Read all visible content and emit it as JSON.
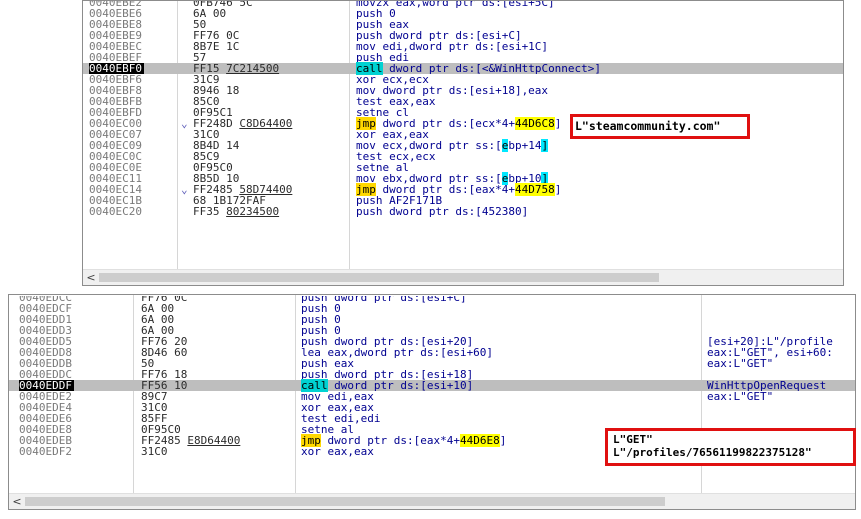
{
  "colors": {
    "selection": "#bebebe",
    "call_highlight": "#00d2d2",
    "jmp_highlight": "#ffd800",
    "callout_border": "#e01010"
  },
  "top_pane": {
    "rows": [
      {
        "addr": "0040EBE2",
        "arrow": "",
        "bytes": "0FB746 5C",
        "ref": "",
        "instr": [
          {
            "t": "movzx eax,word ptr ds:[esi+5C]"
          }
        ],
        "cut": true
      },
      {
        "addr": "0040EBE6",
        "arrow": "",
        "bytes": "6A 00",
        "ref": "",
        "instr": [
          {
            "t": "push 0"
          }
        ]
      },
      {
        "addr": "0040EBE8",
        "arrow": "",
        "bytes": "50",
        "ref": "",
        "instr": [
          {
            "t": "push eax"
          }
        ]
      },
      {
        "addr": "0040EBE9",
        "arrow": "",
        "bytes": "FF76 0C",
        "ref": "",
        "instr": [
          {
            "t": "push dword ptr ds:[esi+C]"
          }
        ]
      },
      {
        "addr": "0040EBEC",
        "arrow": "",
        "bytes": "8B7E 1C",
        "ref": "",
        "instr": [
          {
            "t": "mov edi,dword ptr ds:[esi+1C]"
          }
        ]
      },
      {
        "addr": "0040EBEF",
        "arrow": "",
        "bytes": "57",
        "ref": "",
        "instr": [
          {
            "t": "push edi"
          }
        ]
      },
      {
        "addr": "0040EBF0",
        "arrow": "",
        "bytes": "FF15 ",
        "ref": "7C214500",
        "instr": [
          {
            "t": "call",
            "c": "call"
          },
          {
            "t": " dword ptr ds:[<&WinHttpConnect>]"
          }
        ],
        "selected": true
      },
      {
        "addr": "0040EBF6",
        "arrow": "",
        "bytes": "31C9",
        "ref": "",
        "instr": [
          {
            "t": "xor ecx,ecx"
          }
        ]
      },
      {
        "addr": "0040EBF8",
        "arrow": "",
        "bytes": "8946 18",
        "ref": "",
        "instr": [
          {
            "t": "mov dword ptr ds:[esi+18],eax"
          }
        ]
      },
      {
        "addr": "0040EBFB",
        "arrow": "",
        "bytes": "85C0",
        "ref": "",
        "instr": [
          {
            "t": "test eax,eax"
          }
        ]
      },
      {
        "addr": "0040EBFD",
        "arrow": "",
        "bytes": "0F95C1",
        "ref": "",
        "instr": [
          {
            "t": "setne cl"
          }
        ]
      },
      {
        "addr": "0040EC00",
        "arrow": "⌄",
        "bytes": "FF248D ",
        "ref": "C8D64400",
        "instr": [
          {
            "t": "jmp",
            "c": "jmp"
          },
          {
            "t": " dword ptr ds:[ecx*4+"
          },
          {
            "t": "44D6C8",
            "c": "hl"
          },
          {
            "t": "]"
          }
        ]
      },
      {
        "addr": "0040EC07",
        "arrow": "",
        "bytes": "31C0",
        "ref": "",
        "instr": [
          {
            "t": "xor eax,eax"
          }
        ]
      },
      {
        "addr": "0040EC09",
        "arrow": "",
        "bytes": "8B4D 14",
        "ref": "",
        "instr": [
          {
            "t": "mov ecx,dword ptr ss:["
          },
          {
            "t": "e",
            "c": "br"
          },
          {
            "t": "bp+14"
          },
          {
            "t": "]",
            "c": "br"
          }
        ]
      },
      {
        "addr": "0040EC0C",
        "arrow": "",
        "bytes": "85C9",
        "ref": "",
        "instr": [
          {
            "t": "test ecx,ecx"
          }
        ]
      },
      {
        "addr": "0040EC0E",
        "arrow": "",
        "bytes": "0F95C0",
        "ref": "",
        "instr": [
          {
            "t": "setne al"
          }
        ]
      },
      {
        "addr": "0040EC11",
        "arrow": "",
        "bytes": "8B5D 10",
        "ref": "",
        "instr": [
          {
            "t": "mov ebx,dword ptr ss:["
          },
          {
            "t": "e",
            "c": "br"
          },
          {
            "t": "bp+10"
          },
          {
            "t": "]",
            "c": "br"
          }
        ]
      },
      {
        "addr": "0040EC14",
        "arrow": "⌄",
        "bytes": "FF2485 ",
        "ref": "58D74400",
        "instr": [
          {
            "t": "jmp",
            "c": "jmp"
          },
          {
            "t": " dword ptr ds:[eax*4+"
          },
          {
            "t": "44D758",
            "c": "hl"
          },
          {
            "t": "]"
          }
        ]
      },
      {
        "addr": "0040EC1B",
        "arrow": "",
        "bytes": "68 1B172FAF",
        "ref": "",
        "instr": [
          {
            "t": "push AF2F171B"
          }
        ]
      },
      {
        "addr": "0040EC20",
        "arrow": "",
        "bytes": "FF35 ",
        "ref": "80234500",
        "instr": [
          {
            "t": "push dword ptr ds:[452380]"
          }
        ]
      }
    ],
    "callout": "L\"steamcommunity.com\""
  },
  "bottom_pane": {
    "rows": [
      {
        "addr": "0040EDCC",
        "bytes": "FF76 0C",
        "ref": "",
        "instr": [
          {
            "t": "push dword ptr ds:[esi+C]"
          }
        ],
        "comment": "",
        "cut": true
      },
      {
        "addr": "0040EDCF",
        "bytes": "6A 00",
        "ref": "",
        "instr": [
          {
            "t": "push 0"
          }
        ],
        "comment": ""
      },
      {
        "addr": "0040EDD1",
        "bytes": "6A 00",
        "ref": "",
        "instr": [
          {
            "t": "push 0"
          }
        ],
        "comment": ""
      },
      {
        "addr": "0040EDD3",
        "bytes": "6A 00",
        "ref": "",
        "instr": [
          {
            "t": "push 0"
          }
        ],
        "comment": ""
      },
      {
        "addr": "0040EDD5",
        "bytes": "FF76 20",
        "ref": "",
        "instr": [
          {
            "t": "push dword ptr ds:[esi+20]"
          }
        ],
        "comment": "[esi+20]:L\"/profile"
      },
      {
        "addr": "0040EDD8",
        "bytes": "8D46 60",
        "ref": "",
        "instr": [
          {
            "t": "lea eax,dword ptr ds:[esi+60]"
          }
        ],
        "comment": "eax:L\"GET\", esi+60:"
      },
      {
        "addr": "0040EDDB",
        "bytes": "50",
        "ref": "",
        "instr": [
          {
            "t": "push eax"
          }
        ],
        "comment": "eax:L\"GET\""
      },
      {
        "addr": "0040EDDC",
        "bytes": "FF76 18",
        "ref": "",
        "instr": [
          {
            "t": "push dword ptr ds:[esi+18]"
          }
        ],
        "comment": ""
      },
      {
        "addr": "0040EDDF",
        "bytes": "FF56 10",
        "ref": "",
        "instr": [
          {
            "t": "call",
            "c": "call"
          },
          {
            "t": " dword ptr ds:[esi+10]"
          }
        ],
        "comment": "WinHttpOpenRequest",
        "selected": true
      },
      {
        "addr": "0040EDE2",
        "bytes": "89C7",
        "ref": "",
        "instr": [
          {
            "t": "mov edi,eax"
          }
        ],
        "comment": "eax:L\"GET\""
      },
      {
        "addr": "0040EDE4",
        "bytes": "31C0",
        "ref": "",
        "instr": [
          {
            "t": "xor eax,eax"
          }
        ],
        "comment": ""
      },
      {
        "addr": "0040EDE6",
        "bytes": "85FF",
        "ref": "",
        "instr": [
          {
            "t": "test edi,edi"
          }
        ],
        "comment": ""
      },
      {
        "addr": "0040EDE8",
        "bytes": "0F95C0",
        "ref": "",
        "instr": [
          {
            "t": "setne al"
          }
        ],
        "comment": ""
      },
      {
        "addr": "0040EDEB",
        "bytes": "FF2485 ",
        "ref": "E8D64400",
        "instr": [
          {
            "t": "jmp",
            "c": "jmp"
          },
          {
            "t": " dword ptr ds:[eax*4+"
          },
          {
            "t": "44D6E8",
            "c": "hl"
          },
          {
            "t": "]"
          }
        ],
        "comment": ""
      },
      {
        "addr": "0040EDF2",
        "bytes": "31C0",
        "ref": "",
        "instr": [
          {
            "t": "xor eax,eax"
          }
        ],
        "comment": "eax:L\"GET\""
      }
    ],
    "callout": [
      "L\"GET\"",
      "L\"/profiles/76561199822375128\""
    ]
  },
  "scrollbar": {
    "left_arrow": "<"
  }
}
